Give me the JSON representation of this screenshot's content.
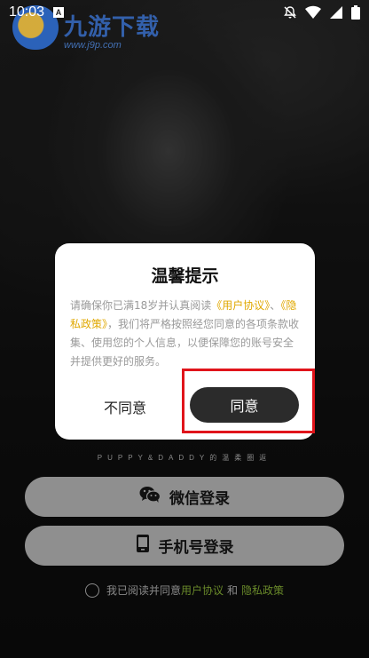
{
  "status_bar": {
    "time": "10:03",
    "notification_badge": "A",
    "icons": [
      "notifications-off-icon",
      "wifi-icon",
      "signal-icon",
      "battery-icon"
    ]
  },
  "watermark": {
    "name": "九游下载",
    "url": "www.j9p.com"
  },
  "dialog": {
    "title": "温馨提示",
    "body_prefix": "请确保你已满18岁并认真阅读",
    "link_user_agreement": "《用户协议》",
    "separator": "、",
    "link_privacy_policy": "《隐私政策》",
    "body_suffix": "，我们将严格按照经您同意的各项条款收集、使用您的个人信息，以便保障您的账号安全并提供更好的服务。",
    "disagree_label": "不同意",
    "agree_label": "同意"
  },
  "brand_tagline": "PUPPY&DADDY的温柔圈返",
  "login": {
    "wechat_label": "微信登录",
    "phone_label": "手机号登录"
  },
  "agreement": {
    "prefix": "我已阅读并同意",
    "user_agreement": "用户协议",
    "and": "和",
    "privacy_policy": "隐私政策"
  },
  "colors": {
    "accent_link": "#e0a800",
    "agree_button_bg": "#2b2b2b",
    "highlight": "#e0141b",
    "login_button_bg": "#8f8f8f"
  }
}
